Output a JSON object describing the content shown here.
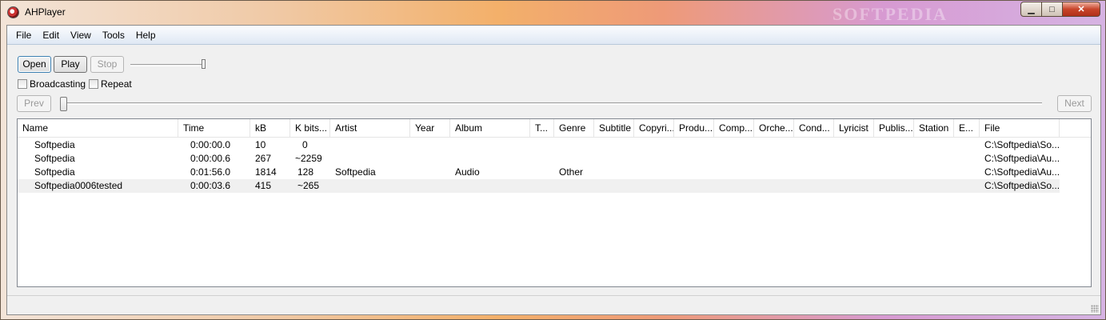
{
  "window": {
    "title": "AHPlayer",
    "watermark": "SOFTPEDIA"
  },
  "menu": [
    "File",
    "Edit",
    "View",
    "Tools",
    "Help"
  ],
  "controls": {
    "open_label": "Open",
    "play_label": "Play",
    "stop_label": "Stop",
    "broadcasting_label": "Broadcasting",
    "repeat_label": "Repeat",
    "prev_label": "Prev",
    "next_label": "Next"
  },
  "playlist": {
    "columns": [
      "Name",
      "Time",
      "kB",
      "K bits...",
      "Artist",
      "Year",
      "Album",
      "T...",
      "Genre",
      "Subtitle",
      "Copyri...",
      "Produ...",
      "Comp...",
      "Orche...",
      "Cond...",
      "Lyricist",
      "Publis...",
      "Station",
      "E...",
      "File"
    ],
    "rows": [
      {
        "name": "Softpedia",
        "time": "0:00:00.0",
        "kb": "10",
        "kbits": "0",
        "artist": "",
        "album": "",
        "genre": "",
        "file": "C:\\Softpedia\\So..."
      },
      {
        "name": "Softpedia",
        "time": "0:00:00.6",
        "kb": "267",
        "kbits": "~2259",
        "artist": "",
        "album": "",
        "genre": "",
        "file": "C:\\Softpedia\\Au..."
      },
      {
        "name": "Softpedia",
        "time": "0:01:56.0",
        "kb": "1814",
        "kbits": "128",
        "artist": "Softpedia",
        "album": "Audio",
        "genre": "Other",
        "file": "C:\\Softpedia\\Au..."
      },
      {
        "name": "Softpedia0006tested",
        "time": "0:00:03.6",
        "kb": "415",
        "kbits": "~265",
        "artist": "",
        "album": "",
        "genre": "",
        "file": "C:\\Softpedia\\So..."
      }
    ]
  },
  "caption_buttons": {
    "minimize": "▁",
    "maximize": "□",
    "close": "✕"
  }
}
